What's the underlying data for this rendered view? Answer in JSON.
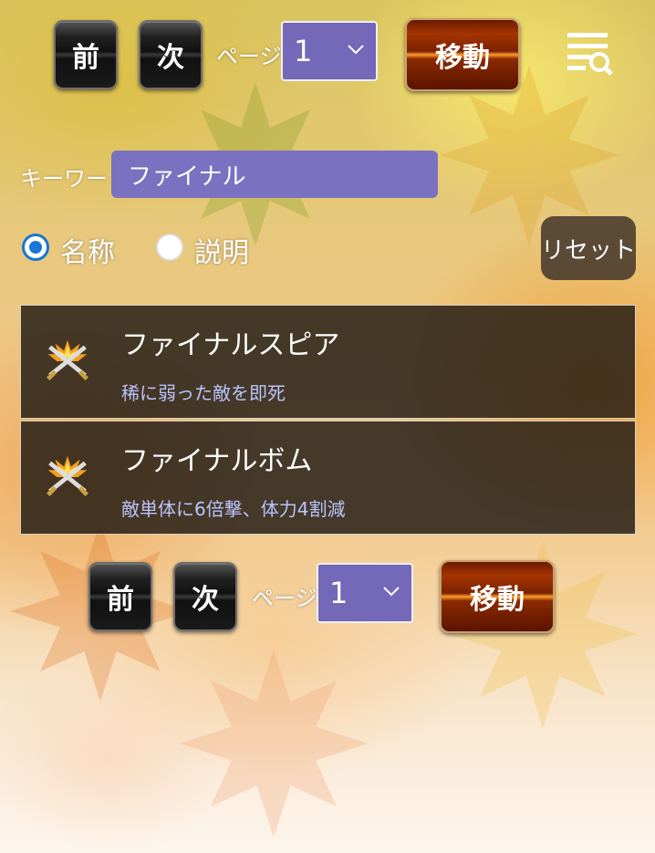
{
  "pager_top": {
    "prev_label": "前",
    "next_label": "次",
    "page_label": "ページ",
    "page_value": "1",
    "move_label": "移動"
  },
  "search": {
    "keyword_label": "キーワード",
    "keyword_value": "ファイナル"
  },
  "filter": {
    "options": [
      {
        "label": "名称",
        "selected": true
      },
      {
        "label": "説明",
        "selected": false
      }
    ],
    "reset_label": "リセット"
  },
  "results": [
    {
      "name": "ファイナルスピア",
      "description": "稀に弱った敵を即死",
      "icon": "crossed-swords-icon"
    },
    {
      "name": "ファイナルボム",
      "description": "敵単体に6倍撃、体力4割減",
      "icon": "crossed-swords-icon"
    }
  ],
  "pager_bottom": {
    "prev_label": "前",
    "next_label": "次",
    "page_label": "ページ",
    "page_value": "1",
    "move_label": "移動"
  },
  "colors": {
    "accent": "#7468b8",
    "radio_selected": "#1976d2",
    "description_text": "#b9c4ff"
  }
}
